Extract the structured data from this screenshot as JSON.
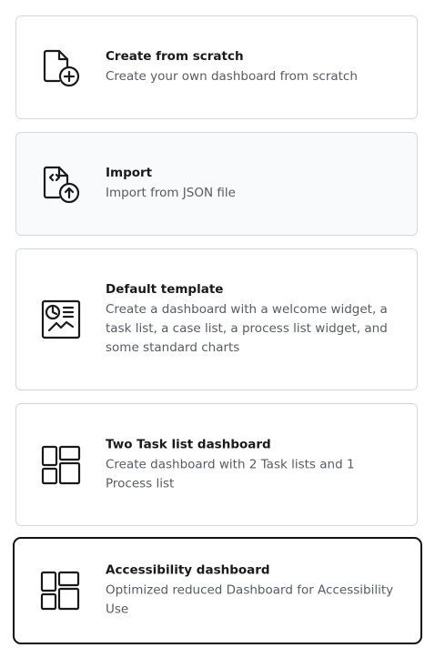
{
  "options": [
    {
      "title": "Create from scratch",
      "description": "Create your own dashboard from scratch",
      "icon": "file-plus-icon"
    },
    {
      "title": "Import",
      "description": "Import from JSON file",
      "icon": "file-code-upload-icon"
    },
    {
      "title": "Default template",
      "description": "Create a dashboard with a welcome widget, a task list, a case list, a process list widget, and some standard charts",
      "icon": "analytics-board-icon"
    },
    {
      "title": "Two Task list dashboard",
      "description": "Create dashboard with 2 Task lists and 1 Process list",
      "icon": "layout-grid-icon"
    },
    {
      "title": "Accessibility dashboard",
      "description": "Optimized reduced Dashboard for Accessibility Use",
      "icon": "layout-grid-icon"
    }
  ],
  "colors": {
    "border": "#d6d9dc",
    "selected_border": "#111111",
    "hover_background": "#f8fafc",
    "description_text": "#585c60"
  }
}
